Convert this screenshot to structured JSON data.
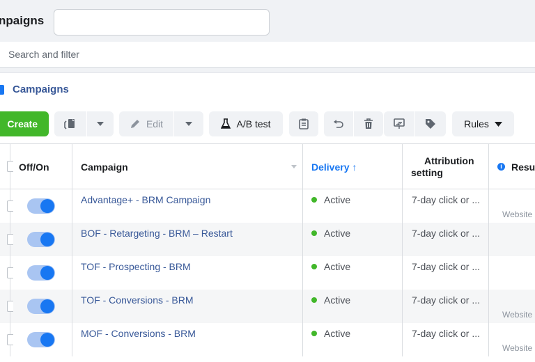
{
  "header": {
    "title": "npaigns",
    "title_field_value": "",
    "search_placeholder": "Search and filter"
  },
  "level_tab": {
    "label": "Campaigns",
    "accent": "#1877f2"
  },
  "toolbar": {
    "create_label": "Create",
    "edit_label": "Edit",
    "ab_test_label": "A/B test",
    "rules_label": "Rules",
    "icons": [
      "duplicate-icon",
      "chevron-down-icon",
      "pencil-icon",
      "chevron-down-icon",
      "flask-icon",
      "clipboard-icon",
      "undo-icon",
      "trash-icon",
      "export-icon",
      "tag-icon",
      "caret-down-icon"
    ],
    "create_color": "#42b72a"
  },
  "table": {
    "columns": {
      "off_on": "Off/On",
      "campaign": "Campaign",
      "delivery": "Delivery ↑",
      "attribution_line1": "Attribution",
      "attribution_line2": "setting",
      "results": "Resul"
    },
    "rows": [
      {
        "on": true,
        "campaign": "Advantage+ - BRM Campaign",
        "delivery": "Active",
        "attribution": "7-day click or ...",
        "results": "Website"
      },
      {
        "on": true,
        "campaign": "BOF - Retargeting - BRM – Restart",
        "delivery": "Active",
        "attribution": "7-day click or ...",
        "results": ""
      },
      {
        "on": true,
        "campaign": "TOF - Prospecting - BRM",
        "delivery": "Active",
        "attribution": "7-day click or ...",
        "results": ""
      },
      {
        "on": true,
        "campaign": "TOF - Conversions - BRM",
        "delivery": "Active",
        "attribution": "7-day click or ...",
        "results": "Website"
      },
      {
        "on": true,
        "campaign": "MOF - Conversions - BRM",
        "delivery": "Active",
        "attribution": "7-day click or ...",
        "results": "Website"
      }
    ],
    "status_color": "#42b72a",
    "link_color": "#385898",
    "toggle_color": "#1877f2"
  }
}
